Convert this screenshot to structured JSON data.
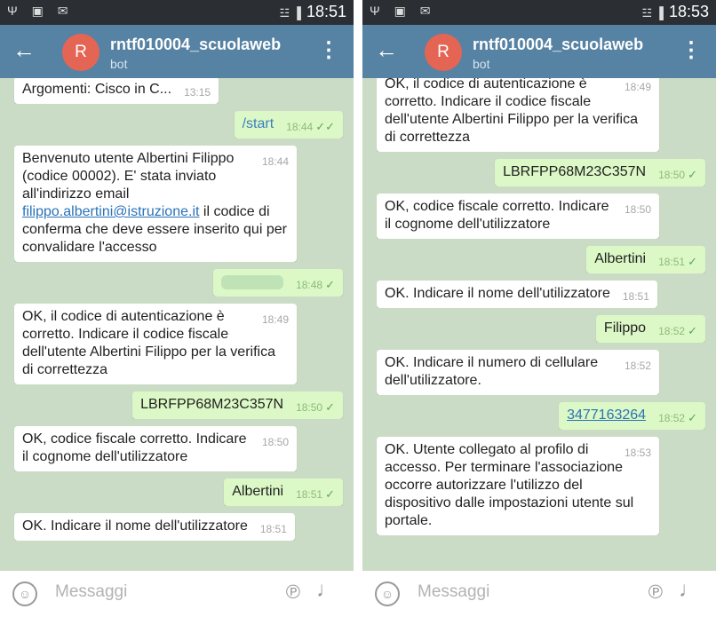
{
  "screens": [
    {
      "status": {
        "time": "18:51",
        "left_icons": "Ψ ▣ ✉",
        "signal": "☳ ▐"
      },
      "header": {
        "avatar_letter": "R",
        "title": "rntf010004_scuolaweb",
        "subtitle": "bot",
        "back_icon": "←",
        "menu_icon": "⋮"
      },
      "input": {
        "placeholder": "Messaggi",
        "emoji_icon": "☺",
        "clip_icon": "℗",
        "mic_icon": "♩"
      },
      "messages": [
        {
          "dir": "in",
          "text": "Argomenti: Cisco in C...",
          "time": "13:15"
        },
        {
          "dir": "out",
          "text": "/start",
          "time": "18:44",
          "check": "✓✓",
          "command": true
        },
        {
          "dir": "in",
          "text_before": "Benvenuto utente Albertini Filippo (codice 00002). E' stata inviato all'indirizzo email ",
          "link": "filippo.albertini@istruzione.it",
          "text_after": " il codice di conferma che deve essere inserito qui per convalidare l'accesso",
          "time": "18:44"
        },
        {
          "dir": "out",
          "text": "",
          "blurred": true,
          "time": "18:48",
          "check": "✓"
        },
        {
          "dir": "in",
          "text": "OK, il codice di autenticazione è corretto. Indicare il codice fiscale dell'utente Albertini Filippo per la verifica di correttezza",
          "time": "18:49"
        },
        {
          "dir": "out",
          "text": "LBRFPP68M23C357N",
          "time": "18:50",
          "check": "✓"
        },
        {
          "dir": "in",
          "text": "OK, codice fiscale corretto. Indicare il cognome dell'utilizzatore",
          "time": "18:50"
        },
        {
          "dir": "out",
          "text": "Albertini",
          "time": "18:51",
          "check": "✓"
        },
        {
          "dir": "in",
          "text": "OK. Indicare il nome dell'utilizzatore",
          "time": "18:51"
        }
      ]
    },
    {
      "status": {
        "time": "18:53",
        "left_icons": "Ψ ▣ ✉",
        "signal": "☳ ▐"
      },
      "header": {
        "avatar_letter": "R",
        "title": "rntf010004_scuolaweb",
        "subtitle": "bot",
        "back_icon": "←",
        "menu_icon": "⋮"
      },
      "input": {
        "placeholder": "Messaggi",
        "emoji_icon": "☺",
        "clip_icon": "℗",
        "mic_icon": "♩"
      },
      "messages": [
        {
          "dir": "in",
          "text": "OK, il codice di autenticazione è corretto. Indicare il codice fiscale dell'utente Albertini Filippo per la verifica di correttezza",
          "time": "18:49"
        },
        {
          "dir": "out",
          "text": "LBRFPP68M23C357N",
          "time": "18:50",
          "check": "✓"
        },
        {
          "dir": "in",
          "text": "OK, codice fiscale corretto. Indicare il cognome dell'utilizzatore",
          "time": "18:50"
        },
        {
          "dir": "out",
          "text": "Albertini",
          "time": "18:51",
          "check": "✓"
        },
        {
          "dir": "in",
          "text": "OK. Indicare il nome dell'utilizzatore",
          "time": "18:51"
        },
        {
          "dir": "out",
          "text": "Filippo",
          "time": "18:52",
          "check": "✓"
        },
        {
          "dir": "in",
          "text": "OK. Indicare il numero di cellulare dell'utilizzatore.",
          "time": "18:52"
        },
        {
          "dir": "out",
          "text": "3477163264",
          "time": "18:52",
          "check": "✓",
          "link_style": true
        },
        {
          "dir": "in",
          "text": "OK. Utente collegato al profilo di accesso. Per terminare l'associazione occorre autorizzare l'utilizzo del dispositivo dalle impostazioni utente sul portale.",
          "time": "18:53"
        }
      ]
    }
  ]
}
